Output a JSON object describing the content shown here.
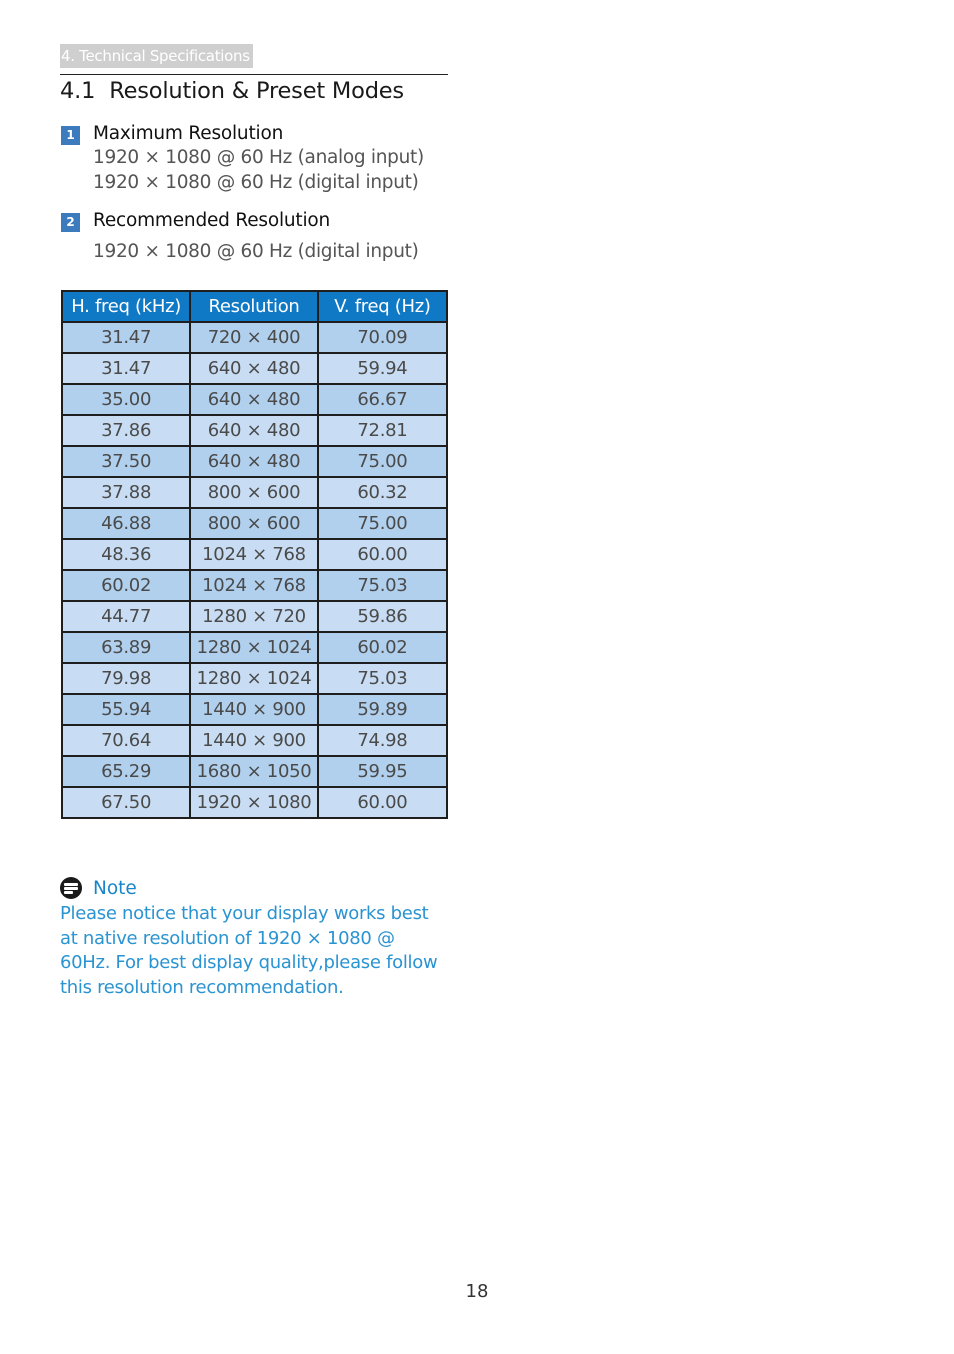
{
  "header": {
    "section_tag": "4. Technical Specifications",
    "title_number": "4.1",
    "title": "Resolution & Preset Modes"
  },
  "items": [
    {
      "badge": "1",
      "heading": "Maximum Resolution",
      "lines": [
        "1920 × 1080 @ 60 Hz (analog input)",
        "1920 × 1080 @ 60 Hz (digital input)"
      ]
    },
    {
      "badge": "2",
      "heading": "Recommended Resolution",
      "lines": [
        "1920 × 1080 @ 60 Hz (digital input)"
      ]
    }
  ],
  "table": {
    "headers": [
      "H. freq (kHz)",
      "Resolution",
      "V. freq (Hz)"
    ],
    "rows": [
      [
        "31.47",
        "720 × 400",
        "70.09"
      ],
      [
        "31.47",
        "640 × 480",
        "59.94"
      ],
      [
        "35.00",
        "640 × 480",
        "66.67"
      ],
      [
        "37.86",
        "640 × 480",
        "72.81"
      ],
      [
        "37.50",
        "640 × 480",
        "75.00"
      ],
      [
        "37.88",
        "800 × 600",
        "60.32"
      ],
      [
        "46.88",
        "800 × 600",
        "75.00"
      ],
      [
        "48.36",
        "1024 × 768",
        "60.00"
      ],
      [
        "60.02",
        "1024 × 768",
        "75.03"
      ],
      [
        "44.77",
        "1280 × 720",
        "59.86"
      ],
      [
        "63.89",
        "1280 × 1024",
        "60.02"
      ],
      [
        "79.98",
        "1280 × 1024",
        "75.03"
      ],
      [
        "55.94",
        "1440 × 900",
        "59.89"
      ],
      [
        "70.64",
        "1440 × 900",
        "74.98"
      ],
      [
        "65.29",
        "1680 × 1050",
        "59.95"
      ],
      [
        "67.50",
        "1920 × 1080",
        "60.00"
      ]
    ]
  },
  "note": {
    "icon": "note-icon",
    "title": "Note",
    "body": "Please notice that your display works best at native resolution of 1920 × 1080 @ 60Hz. For best display quality,please follow this resolution recommendation."
  },
  "footer": {
    "page_number": "18"
  },
  "colors": {
    "accent_blue": "#1079c6",
    "badge_blue": "#3d7bbf",
    "row_dark": "#b0d0ee",
    "row_light": "#c8ddf3",
    "note_text": "#2a93d1"
  }
}
